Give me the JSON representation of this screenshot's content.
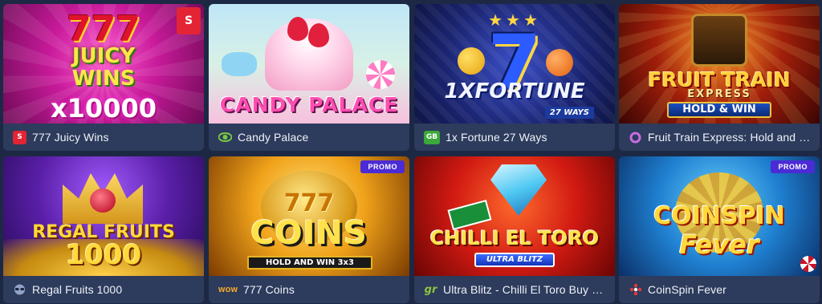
{
  "games": [
    {
      "title": "777 Juicy Wins",
      "provider_icon": "s-box-icon",
      "promo": ""
    },
    {
      "title": "Candy Palace",
      "provider_icon": "green-eye-icon",
      "promo": ""
    },
    {
      "title": "1x Fortune 27 Ways",
      "provider_icon": "gb-badge-icon",
      "provider_text": "GB",
      "promo": ""
    },
    {
      "title": "Fruit Train Express: Hold and Win",
      "provider_icon": "ring-icon",
      "promo": ""
    },
    {
      "title": "Regal Fruits 1000",
      "provider_icon": "sunglasses-icon",
      "promo": ""
    },
    {
      "title": "777 Coins",
      "provider_icon": "wow-icon",
      "provider_text": "WOW",
      "promo": "PROMO"
    },
    {
      "title": "Ultra Blitz - Chilli El Toro Buy Bon…",
      "provider_icon": "gr-logo-icon",
      "provider_text": "gr",
      "promo": ""
    },
    {
      "title": "CoinSpin Fever",
      "provider_icon": "dots-cluster-icon",
      "promo": "PROMO"
    }
  ],
  "art": {
    "c1": {
      "sevens": "777",
      "line1": "JUICY",
      "line2": "WINS",
      "mult": "x10000",
      "badge": "S"
    },
    "c2": {
      "name": "CANDY PALACE"
    },
    "c3": {
      "stars": "★★★",
      "seven": "7",
      "name": "1XFORTUNE",
      "ways": "27 WAYS"
    },
    "c4": {
      "name": "FRUIT TRAIN",
      "express": "EXPRESS",
      "hw": "HOLD & WIN"
    },
    "c5": {
      "name": "REGAL FRUITS",
      "num": "1000"
    },
    "c6": {
      "sevens": "777",
      "name": "COINS",
      "hw": "HOLD AND WIN 3x3"
    },
    "c7": {
      "name": "CHILLI EL TORO",
      "ub": "ULTRA BLITZ"
    },
    "c8": {
      "name": "COINSPIN",
      "sub": "Fever"
    }
  },
  "colors": {
    "page_bg": "#1d2944",
    "caption_bg": "#2d3b5c",
    "promo_bg": "#4b2bd6"
  }
}
